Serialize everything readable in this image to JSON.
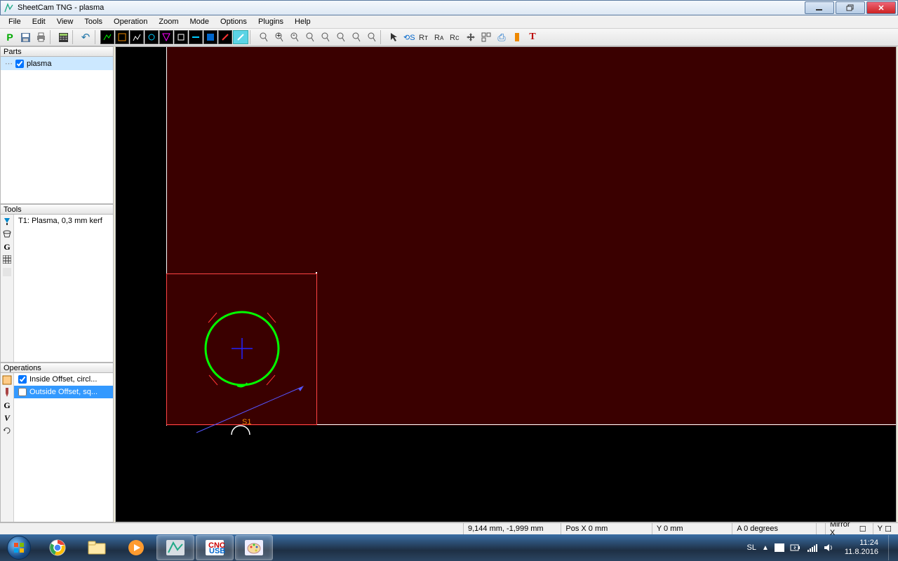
{
  "window": {
    "title": "SheetCam TNG - plasma"
  },
  "menu": {
    "items": [
      "File",
      "Edit",
      "View",
      "Tools",
      "Operation",
      "Zoom",
      "Mode",
      "Options",
      "Plugins",
      "Help"
    ]
  },
  "panels": {
    "parts_title": "Parts",
    "tools_title": "Tools",
    "ops_title": "Operations"
  },
  "parts": {
    "items": [
      {
        "label": "plasma",
        "checked": true
      }
    ]
  },
  "tools": {
    "items": [
      {
        "label": "T1: Plasma, 0,3 mm kerf"
      }
    ]
  },
  "operations": {
    "items": [
      {
        "label": "Inside Offset, circl...",
        "checked": true,
        "selected": false
      },
      {
        "label": "Outside Offset, sq...",
        "checked": false,
        "selected": true
      }
    ]
  },
  "canvas": {
    "start_label": "S1"
  },
  "statusbar": {
    "coords": "9,144 mm, -1,999 mm",
    "posx": "Pos X  0 mm",
    "posy": "Y  0 mm",
    "angle": "A  0 degrees",
    "mirrorx": "Mirror X",
    "mirrory": "Y"
  },
  "taskbar": {
    "lang": "SL",
    "time": "11:24",
    "date": "11.8.2016"
  }
}
